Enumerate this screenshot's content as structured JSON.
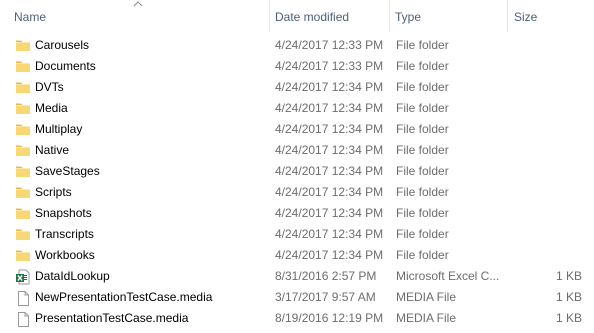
{
  "columns": {
    "name": "Name",
    "date_modified": "Date modified",
    "type": "Type",
    "size": "Size"
  },
  "files": [
    {
      "name": "Carousels",
      "date": "4/24/2017 12:33 PM",
      "type": "File folder",
      "size": "",
      "icon": "folder-icon"
    },
    {
      "name": "Documents",
      "date": "4/24/2017 12:33 PM",
      "type": "File folder",
      "size": "",
      "icon": "folder-icon"
    },
    {
      "name": "DVTs",
      "date": "4/24/2017 12:34 PM",
      "type": "File folder",
      "size": "",
      "icon": "folder-icon"
    },
    {
      "name": "Media",
      "date": "4/24/2017 12:34 PM",
      "type": "File folder",
      "size": "",
      "icon": "folder-icon"
    },
    {
      "name": "Multiplay",
      "date": "4/24/2017 12:34 PM",
      "type": "File folder",
      "size": "",
      "icon": "folder-icon"
    },
    {
      "name": "Native",
      "date": "4/24/2017 12:34 PM",
      "type": "File folder",
      "size": "",
      "icon": "folder-icon"
    },
    {
      "name": "SaveStages",
      "date": "4/24/2017 12:34 PM",
      "type": "File folder",
      "size": "",
      "icon": "folder-icon"
    },
    {
      "name": "Scripts",
      "date": "4/24/2017 12:34 PM",
      "type": "File folder",
      "size": "",
      "icon": "folder-icon"
    },
    {
      "name": "Snapshots",
      "date": "4/24/2017 12:34 PM",
      "type": "File folder",
      "size": "",
      "icon": "folder-icon"
    },
    {
      "name": "Transcripts",
      "date": "4/24/2017 12:34 PM",
      "type": "File folder",
      "size": "",
      "icon": "folder-icon"
    },
    {
      "name": "Workbooks",
      "date": "4/24/2017 12:34 PM",
      "type": "File folder",
      "size": "",
      "icon": "folder-icon"
    },
    {
      "name": "DataIdLookup",
      "date": "8/31/2016 2:57 PM",
      "type": "Microsoft Excel C...",
      "size": "1 KB",
      "icon": "excel-file-icon"
    },
    {
      "name": "NewPresentationTestCase.media",
      "date": "3/17/2017 9:57 AM",
      "type": "MEDIA File",
      "size": "1 KB",
      "icon": "file-icon"
    },
    {
      "name": "PresentationTestCase.media",
      "date": "8/19/2016 12:19 PM",
      "type": "MEDIA File",
      "size": "1 KB",
      "icon": "file-icon"
    }
  ],
  "colors": {
    "header_text": "#4c607a",
    "secondary_text": "#6d6d6d",
    "folder_yellow": "#f8d775",
    "excel_green": "#1e7145"
  }
}
